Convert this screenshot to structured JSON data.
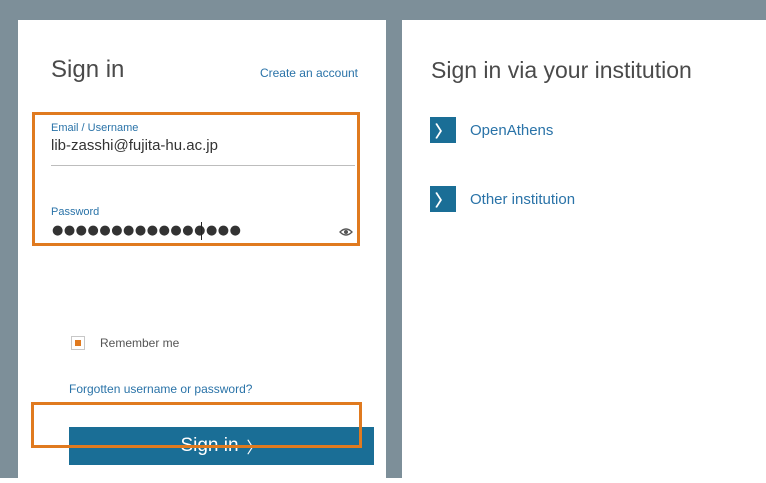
{
  "signin": {
    "title": "Sign in",
    "create_account": "Create an account",
    "email_label": "Email / Username",
    "email_value": "lib-zasshi@fujita-hu.ac.jp",
    "password_label": "Password",
    "password_masked": "●●●●●●●●●●●●●●●●",
    "remember_label": "Remember me",
    "forgot_link": "Forgotten username or password?",
    "button_label": "Sign in",
    "button_chevron": "〉"
  },
  "institution": {
    "title": "Sign in via your institution",
    "items": [
      {
        "label": "OpenAthens",
        "chevron": "〉"
      },
      {
        "label": "Other institution",
        "chevron": "〉"
      }
    ]
  },
  "colors": {
    "accent": "#1a6e96",
    "link": "#2a73a8",
    "highlight": "#e07a1f",
    "frame": "#7d8f99"
  },
  "icons": [
    "eye-icon",
    "chevron-right-icon",
    "checkbox-icon"
  ]
}
